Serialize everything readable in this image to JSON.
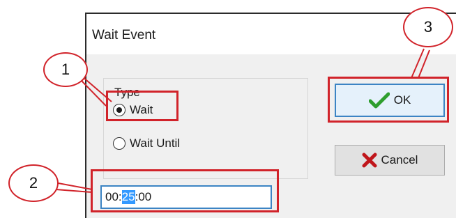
{
  "dialog": {
    "title": "Wait Event",
    "group": {
      "legend": "Type",
      "options": [
        {
          "label": "Wait",
          "checked": true
        },
        {
          "label": "Wait Until",
          "checked": false
        }
      ]
    },
    "time": {
      "hours": "00",
      "sep1": ":",
      "minutes": "25",
      "sep2": ":",
      "seconds": "00",
      "selected_segment": "minutes"
    },
    "buttons": {
      "ok_label": "OK",
      "cancel_label": "Cancel",
      "ok_icon": "checkmark-icon",
      "cancel_icon": "x-icon"
    }
  },
  "annotations": {
    "callout_1": "1",
    "callout_2": "2",
    "callout_3": "3",
    "color": "#d1232a"
  },
  "colors": {
    "focus_border": "#3c84c4",
    "selection": "#3399ff",
    "ok_check": "#2e9e2e",
    "cancel_x": "#c0161b"
  }
}
